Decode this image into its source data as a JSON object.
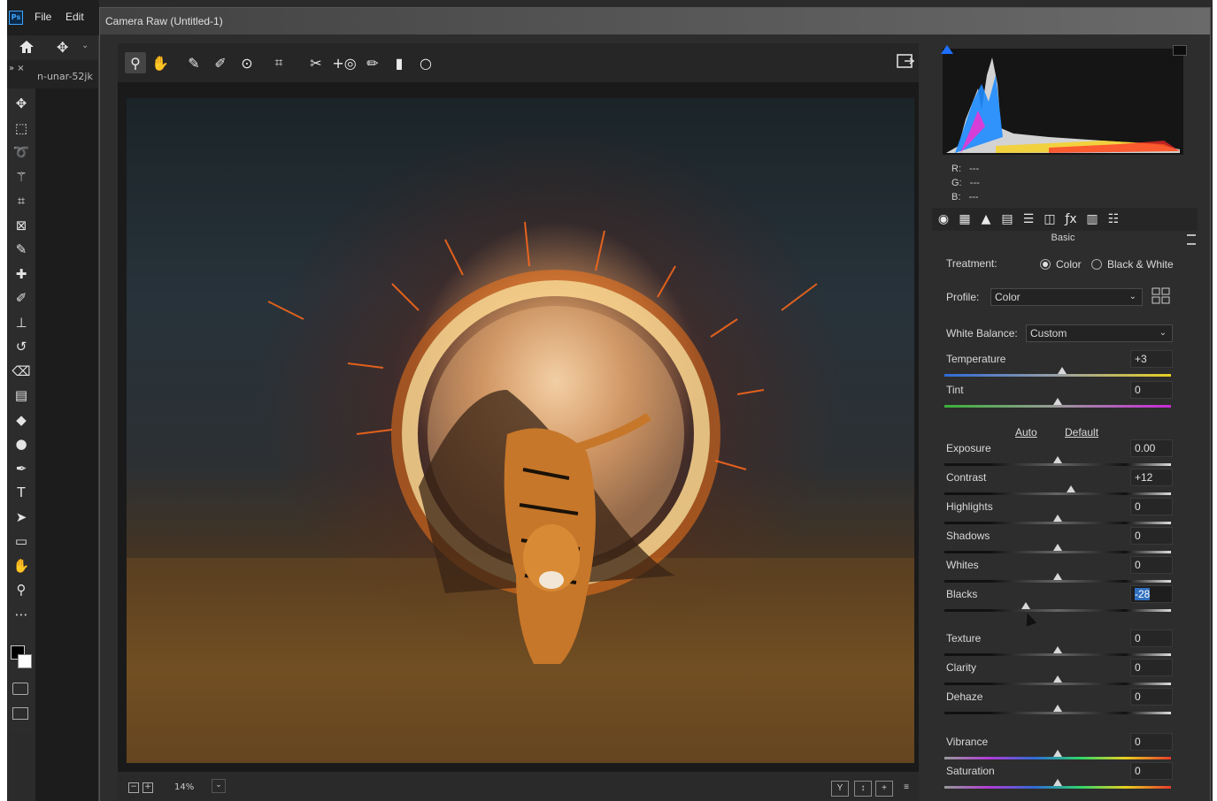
{
  "photoshop": {
    "logo": "Ps",
    "menu": [
      "File",
      "Edit"
    ],
    "doc_tab": "n-unar-52jk",
    "tab_close": "»  ×",
    "tools": [
      "move-icon",
      "marquee-icon",
      "lasso-icon",
      "magic-wand-icon",
      "crop-icon",
      "frame-icon",
      "eyedropper-icon",
      "healing-icon",
      "brush-icon",
      "stamp-icon",
      "history-brush-icon",
      "eraser-icon",
      "gradient-icon",
      "blur-icon",
      "dodge-icon",
      "pen-icon",
      "type-icon",
      "path-select-icon",
      "rectangle-icon",
      "hand-icon",
      "zoom-icon",
      "more-icon"
    ]
  },
  "camera_raw": {
    "title": "Camera Raw (Untitled-1)",
    "toolbar": [
      "zoom-icon",
      "hand-icon",
      "white-balance-icon",
      "color-sampler-icon",
      "targeted-adjust-icon",
      "crop-icon",
      "spot-removal-icon",
      "red-eye-icon",
      "adjustment-brush-icon",
      "graduated-filter-icon",
      "radial-filter-icon"
    ],
    "active_tool": "zoom-icon",
    "zoom": "14%",
    "bottom_buttons": [
      "Y",
      "↕",
      "+",
      "≡"
    ],
    "histogram": {
      "r": "---",
      "g": "---",
      "b": "---",
      "r_label": "R:",
      "g_label": "G:",
      "b_label": "B:"
    },
    "panel_tabs": [
      "basic-icon",
      "tone-curve-icon",
      "detail-icon",
      "hsl-icon",
      "split-toning-icon",
      "lens-icon",
      "fx-icon",
      "calibration-icon",
      "presets-icon"
    ],
    "section": "Basic",
    "treatment": {
      "label": "Treatment:",
      "options": [
        "Color",
        "Black & White"
      ],
      "selected": "Color"
    },
    "profile": {
      "label": "Profile:",
      "value": "Color"
    },
    "white_balance": {
      "label": "White Balance:",
      "value": "Custom"
    },
    "auto": "Auto",
    "default": "Default",
    "sliders": [
      {
        "label": "Temperature",
        "value": "+3",
        "level": 0.52,
        "gradient": "temp"
      },
      {
        "label": "Tint",
        "value": "0",
        "level": 0.5,
        "gradient": "tint"
      },
      {
        "label": "Exposure",
        "value": "0.00",
        "level": 0.5,
        "gradient": "gray"
      },
      {
        "label": "Contrast",
        "value": "+12",
        "level": 0.56,
        "gradient": "gray"
      },
      {
        "label": "Highlights",
        "value": "0",
        "level": 0.5,
        "gradient": "gray"
      },
      {
        "label": "Shadows",
        "value": "0",
        "level": 0.5,
        "gradient": "gray"
      },
      {
        "label": "Whites",
        "value": "0",
        "level": 0.5,
        "gradient": "gray"
      },
      {
        "label": "Blacks",
        "value": "-28",
        "level": 0.36,
        "gradient": "gray",
        "selected": true
      },
      {
        "label": "Texture",
        "value": "0",
        "level": 0.5,
        "gradient": "gray"
      },
      {
        "label": "Clarity",
        "value": "0",
        "level": 0.5,
        "gradient": "gray"
      },
      {
        "label": "Dehaze",
        "value": "0",
        "level": 0.5,
        "gradient": "gray"
      },
      {
        "label": "Vibrance",
        "value": "0",
        "level": 0.5,
        "gradient": "rainbow"
      },
      {
        "label": "Saturation",
        "value": "0",
        "level": 0.5,
        "gradient": "rainbow"
      }
    ]
  }
}
